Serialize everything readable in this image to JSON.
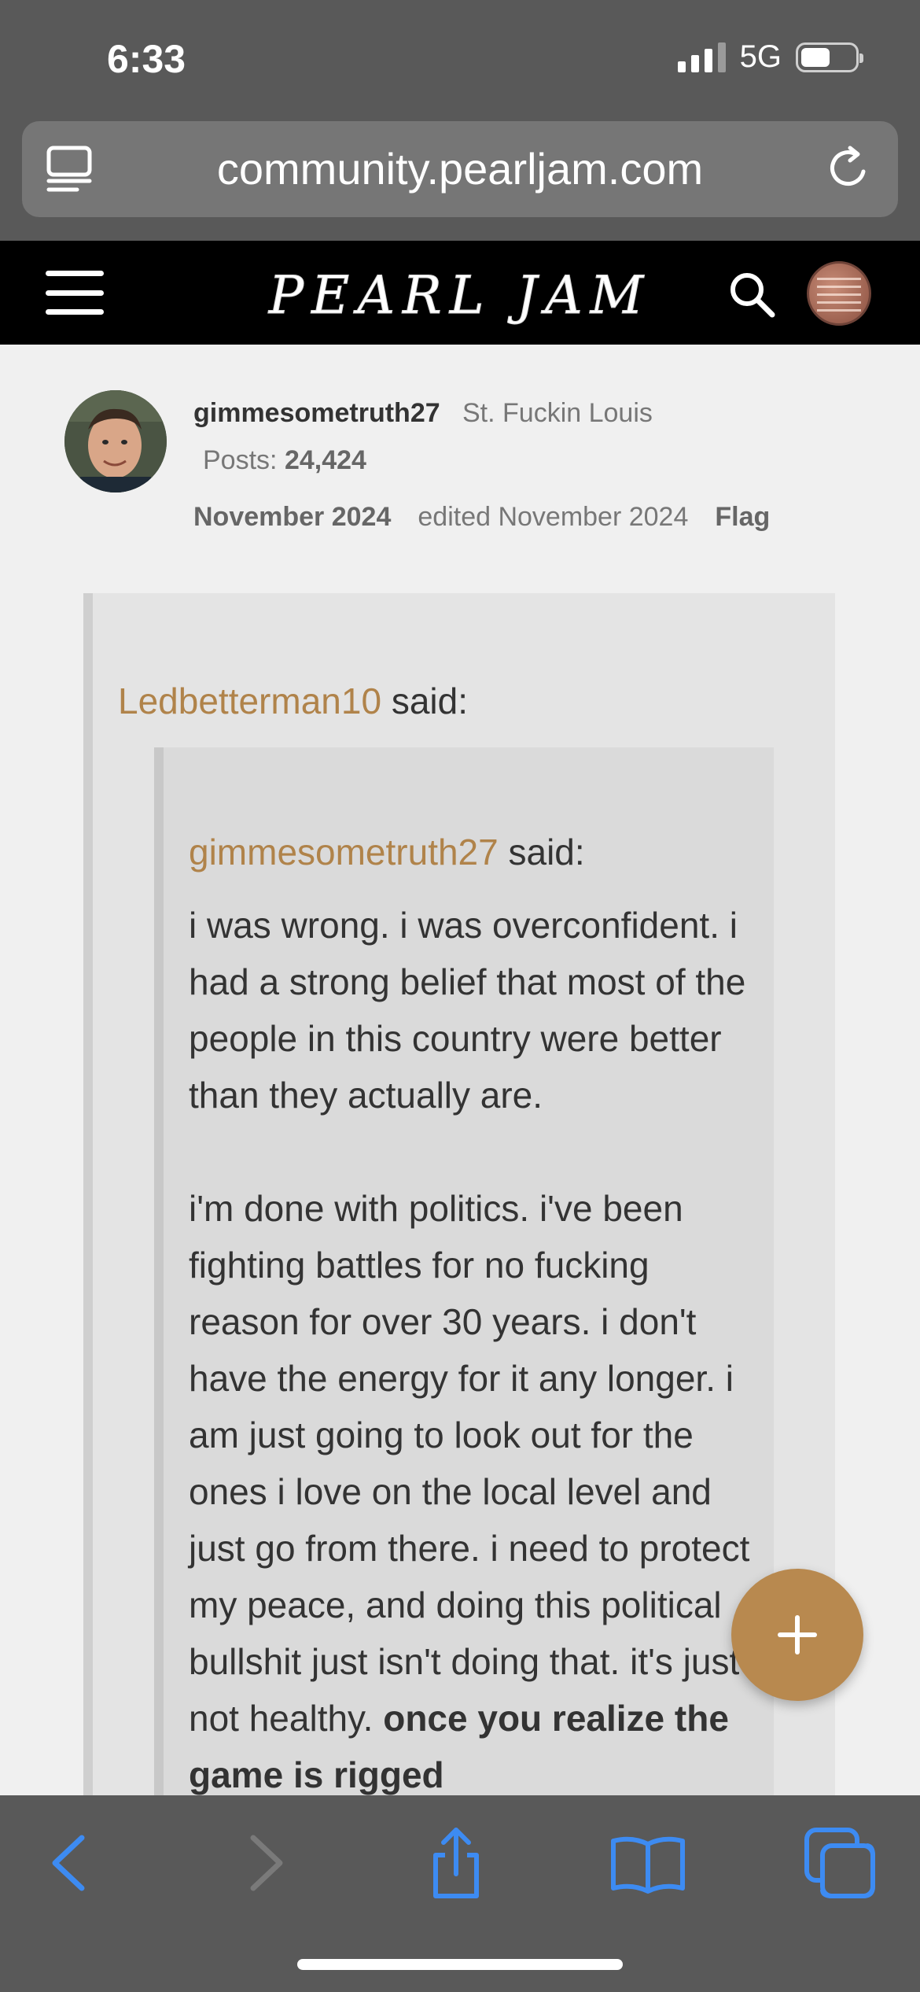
{
  "status_bar": {
    "time": "6:33",
    "network": "5G",
    "battery_level": 0.55
  },
  "browser": {
    "url": "community.pearljam.com"
  },
  "site_header": {
    "logo_text": "PEARL JAM"
  },
  "post": {
    "author": "gimmesometruth27",
    "location": "St. Fuckin Louis",
    "posts_label": "Posts:",
    "posts_count": "24,424",
    "date": "November 2024",
    "edited": "edited November 2024",
    "flag_label": "Flag"
  },
  "quote_outer": {
    "author": "Ledbetterman10",
    "said": "said:"
  },
  "quote_inner": {
    "author": "gimmesometruth27",
    "said": "said:",
    "paragraph_1": "i was wrong. i was overconfident. i had a strong belief that most of the people in this country were better than they actually are.",
    "paragraph_2_plain": "i'm done with politics. i've been fighting battles for no fucking reason for over 30 years. i don't have the energy for it any longer. i am just going to look out for the ones i love on the local level and just go from there. i need to protect my peace, and doing this political bullshit just isn't doing that. it's just not healthy. ",
    "paragraph_2_bold": "once you realize the game is rigged"
  },
  "colors": {
    "accent": "#b8894f",
    "quote_author": "#b0834a",
    "toolbar_icon": "#3d8bf2"
  },
  "icons": {
    "reader": "reader-mode-icon",
    "reload": "reload-icon",
    "menu": "hamburger-menu-icon",
    "search": "search-icon",
    "fab": "plus-icon",
    "back": "chevron-left-icon",
    "forward": "chevron-right-icon",
    "share": "share-icon",
    "bookmarks": "book-icon",
    "tabs": "tabs-icon"
  }
}
